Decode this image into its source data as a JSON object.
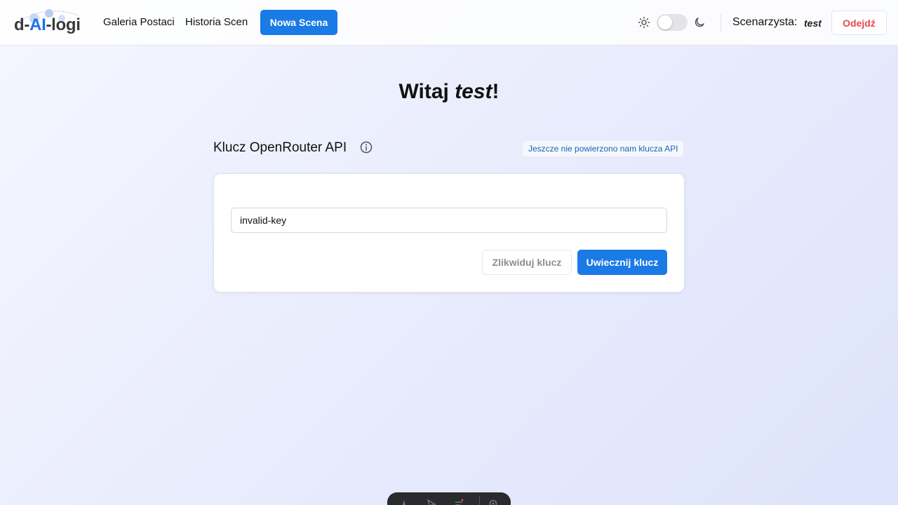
{
  "header": {
    "logo": {
      "prefix": "d-",
      "highlight": "AI",
      "suffix": "-logi"
    },
    "nav": {
      "gallery": "Galeria Postaci",
      "history": "Historia Scen",
      "new_scene": "Nowa Scena"
    },
    "theme": {
      "mode": "light",
      "light_icon": "sun-icon",
      "dark_icon": "moon-icon"
    },
    "author_label": "Scenarzysta:",
    "author_name": "test",
    "leave_button": "Odejdź"
  },
  "main": {
    "welcome_prefix": "Witaj ",
    "welcome_name": "test",
    "welcome_suffix": "!",
    "api_section": {
      "title": "Klucz OpenRouter API",
      "info_icon": "info-icon",
      "status": "Jeszcze nie powierzono nam klucza API",
      "key_value": "invalid-key",
      "delete_button": "Zlikwiduj klucz",
      "save_button": "Uwiecznij klucz"
    }
  },
  "colors": {
    "accent": "#1a7ae6",
    "danger": "#e5484d",
    "status_text": "#1565c0"
  }
}
